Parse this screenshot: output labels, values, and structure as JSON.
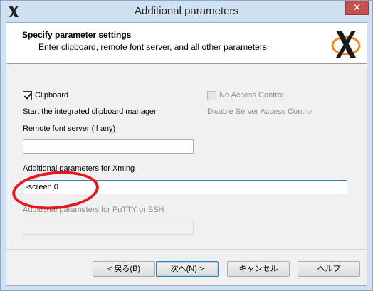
{
  "window": {
    "title": "Additional parameters",
    "close_glyph": "✕"
  },
  "header": {
    "title": "Specify parameter settings",
    "subtitle": "Enter clipboard, remote font server, and all other parameters."
  },
  "clipboard": {
    "label": "Clipboard",
    "checked": true,
    "description": "Start the integrated clipboard manager"
  },
  "no_access_control": {
    "label": "No Access Control",
    "checked": false,
    "enabled": false,
    "description": "Disable Server Access Control"
  },
  "remote_font_server": {
    "label": "Remote font server (if any)",
    "value": ""
  },
  "xming_params": {
    "label": "Additional parameters for Xming",
    "value": "-screen 0"
  },
  "putty_params": {
    "label": "Additional parameters for PuTTY or SSH",
    "value": "",
    "enabled": false
  },
  "buttons": {
    "back": "< 戻る(B)",
    "next": "次へ(N) >",
    "cancel": "キャンセル",
    "help": "ヘルプ"
  },
  "colors": {
    "annotation_ring": "#e8171e",
    "logo_orange": "#f08a1c"
  }
}
